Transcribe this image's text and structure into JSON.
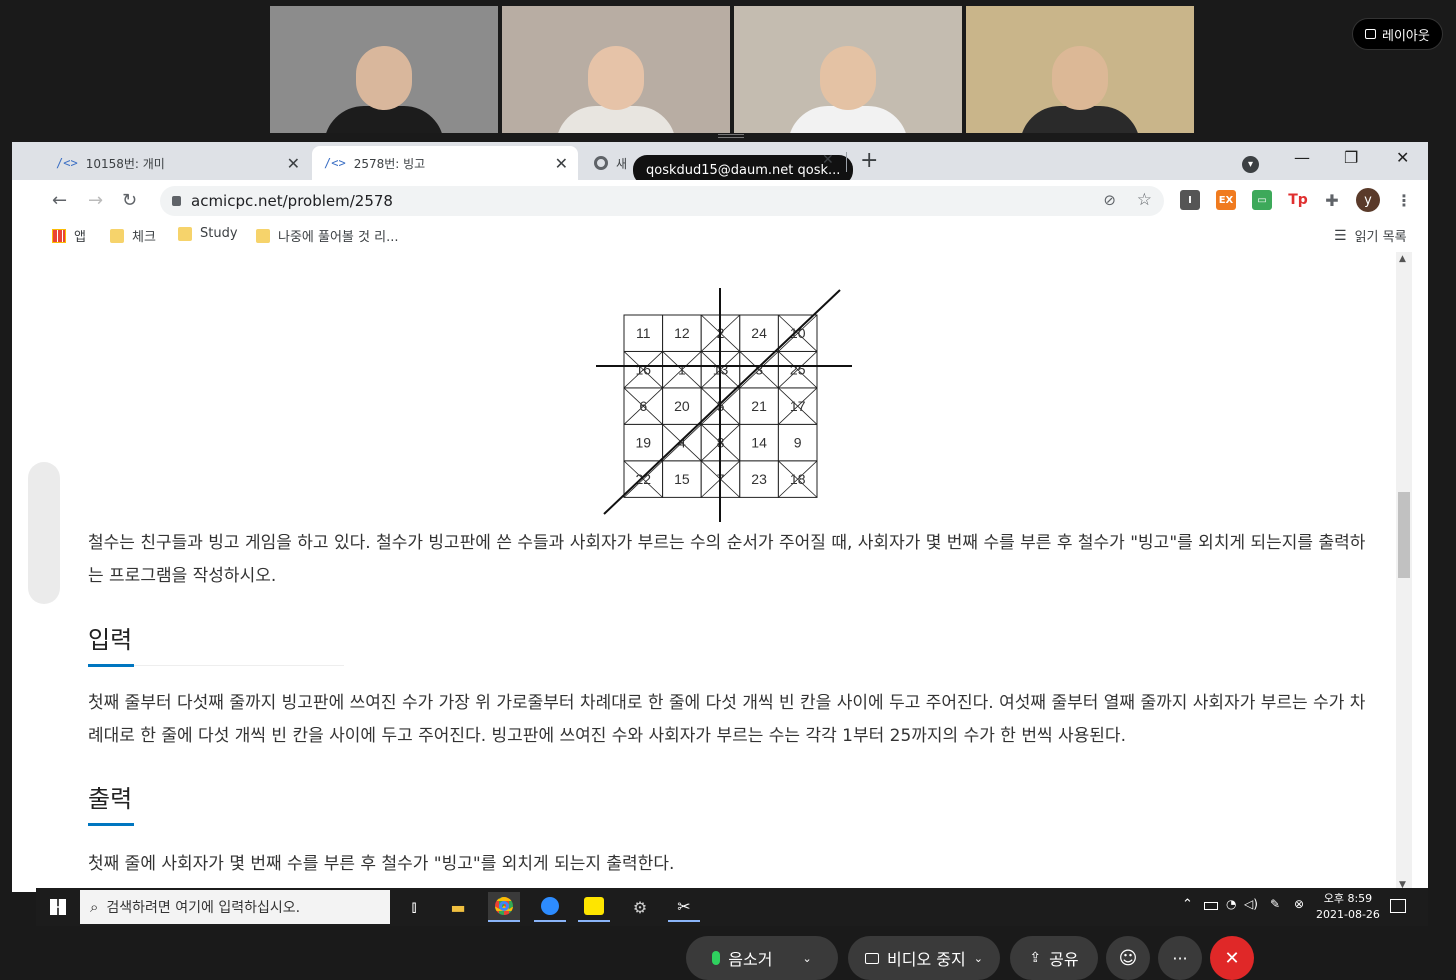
{
  "zoom": {
    "layout_label": "레이아웃",
    "participants": [
      {
        "name": "participant-1",
        "bg": "#8c8c8c",
        "skin": "#d9b79c",
        "shirt": "#1c1c1c"
      },
      {
        "name": "participant-2",
        "bg": "#b8ada3",
        "skin": "#e6c3a8",
        "shirt": "#e8e5e0"
      },
      {
        "name": "participant-3",
        "bg": "#c4bcb0",
        "skin": "#e4c2a4",
        "shirt": "#f2f2f2"
      },
      {
        "name": "participant-4",
        "bg": "#c9b58a",
        "skin": "#dcb896",
        "shirt": "#2a2a2a"
      }
    ],
    "controls": {
      "mute": "음소거",
      "video": "비디오 중지",
      "share": "공유",
      "more": "···"
    }
  },
  "browser": {
    "tabs": [
      {
        "label": "10158번: 개미"
      },
      {
        "label": "2578번: 빙고"
      },
      {
        "label": "새"
      }
    ],
    "tooltip": "qoskdud15@daum.net qosk...",
    "url": "acmicpc.net/problem/2578",
    "profile_initial": "y",
    "bookmarks": [
      {
        "label": "앱"
      },
      {
        "label": "체크"
      },
      {
        "label": "Study"
      },
      {
        "label": "나중에 풀어볼 것 리..."
      }
    ],
    "reading_list": "읽기 목록"
  },
  "problem": {
    "bingo": [
      [
        "11",
        "12",
        "2",
        "24",
        "10"
      ],
      [
        "16",
        "1",
        "13",
        "3",
        "25"
      ],
      [
        "6",
        "20",
        "5",
        "21",
        "17"
      ],
      [
        "19",
        "4",
        "8",
        "14",
        "9"
      ],
      [
        "22",
        "15",
        "7",
        "23",
        "18"
      ]
    ],
    "crossed": [
      [
        false,
        false,
        true,
        false,
        true
      ],
      [
        true,
        true,
        true,
        true,
        true
      ],
      [
        true,
        false,
        true,
        false,
        true
      ],
      [
        false,
        true,
        true,
        false,
        false
      ],
      [
        true,
        false,
        true,
        false,
        true
      ]
    ],
    "description": "철수는 친구들과 빙고 게임을 하고 있다. 철수가 빙고판에 쓴 수들과 사회자가 부르는 수의 순서가 주어질 때, 사회자가 몇 번째 수를 부른 후 철수가 \"빙고\"를 외치게 되는지를 출력하는 프로그램을 작성하시오.",
    "input_heading": "입력",
    "input_text": "첫째 줄부터 다섯째 줄까지 빙고판에 쓰여진 수가 가장 위 가로줄부터 차례대로 한 줄에 다섯 개씩 빈 칸을 사이에 두고 주어진다. 여섯째 줄부터 열째 줄까지 사회자가 부르는 수가 차례대로 한 줄에 다섯 개씩 빈 칸을 사이에 두고 주어진다. 빙고판에 쓰여진 수와 사회자가 부르는 수는 각각 1부터 25까지의 수가 한 번씩 사용된다.",
    "output_heading": "출력",
    "output_text": "첫째 줄에 사회자가 몇 번째 수를 부른 후 철수가 \"빙고\"를 외치게 되는지 출력한다."
  },
  "taskbar": {
    "search_placeholder": "검색하려면 여기에 입력하십시오.",
    "time": "오후 8:59",
    "date": "2021-08-26"
  }
}
